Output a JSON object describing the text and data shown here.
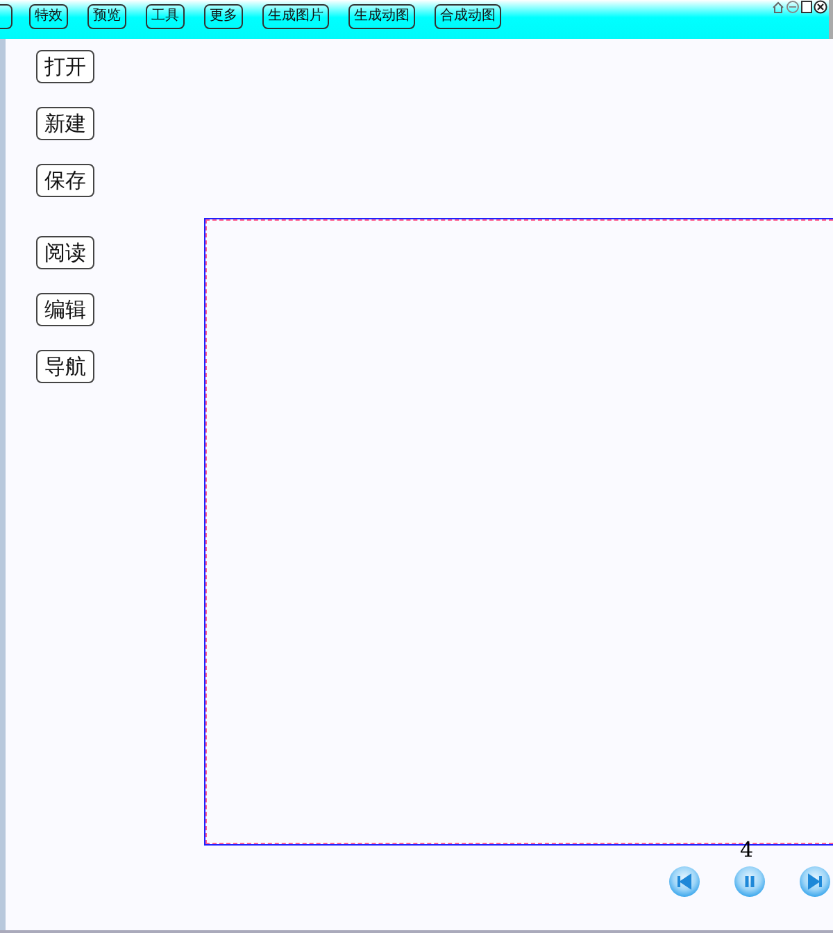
{
  "toolbar": {
    "buttons": [
      "特效",
      "预览",
      "工具",
      "更多",
      "生成图片",
      "生成动图",
      "合成动图"
    ]
  },
  "sidebar": {
    "groups": [
      [
        "打开",
        "新建",
        "保存"
      ],
      [
        "阅读",
        "编辑",
        "导航"
      ]
    ]
  },
  "player": {
    "page": "4"
  }
}
